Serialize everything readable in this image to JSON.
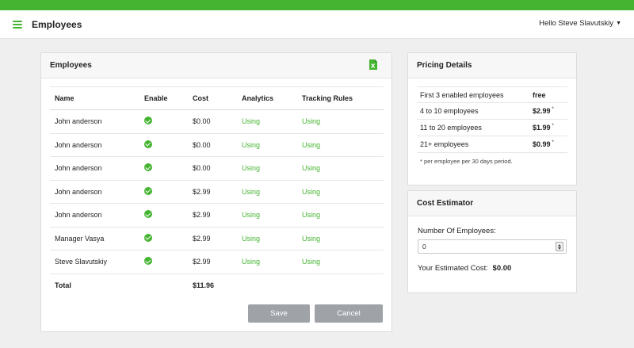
{
  "colors": {
    "accent": "#45b431",
    "button": "#9fa3a8",
    "background": "#efefef"
  },
  "header": {
    "menu_icon": "hamburger-icon",
    "title": "Employees",
    "user_greeting": "Hello Steve Slavutskiy",
    "user_caret": "▼"
  },
  "employees": {
    "title": "Employees",
    "export_icon": "excel-export-icon",
    "columns": {
      "name": "Name",
      "enable": "Enable",
      "cost": "Cost",
      "analytics": "Analytics",
      "tracking_rules": "Tracking Rules"
    },
    "rows": [
      {
        "name": "John anderson",
        "enabled": true,
        "cost": "$0.00",
        "analytics": "Using",
        "tracking_rules": "Using"
      },
      {
        "name": "John anderson",
        "enabled": true,
        "cost": "$0.00",
        "analytics": "Using",
        "tracking_rules": "Using"
      },
      {
        "name": "John anderson",
        "enabled": true,
        "cost": "$0.00",
        "analytics": "Using",
        "tracking_rules": "Using"
      },
      {
        "name": "John anderson",
        "enabled": true,
        "cost": "$2.99",
        "analytics": "Using",
        "tracking_rules": "Using"
      },
      {
        "name": "John anderson",
        "enabled": true,
        "cost": "$2.99",
        "analytics": "Using",
        "tracking_rules": "Using"
      },
      {
        "name": "Manager Vasya",
        "enabled": true,
        "cost": "$2.99",
        "analytics": "Using",
        "tracking_rules": "Using"
      },
      {
        "name": "Steve Slavutskiy",
        "enabled": true,
        "cost": "$2.99",
        "analytics": "Using",
        "tracking_rules": "Using"
      }
    ],
    "total_label": "Total",
    "total_cost": "$11.96",
    "save_label": "Save",
    "cancel_label": "Cancel"
  },
  "pricing": {
    "title": "Pricing Details",
    "tiers": [
      {
        "label": "First 3 enabled employees",
        "price": "free",
        "mark": ""
      },
      {
        "label": "4 to 10 employees",
        "price": "$2.99",
        "mark": "*"
      },
      {
        "label": "11 to 20 employees",
        "price": "$1.99",
        "mark": "*"
      },
      {
        "label": "21+ employees",
        "price": "$0.99",
        "mark": "*"
      }
    ],
    "note": "* per employee per 30 days period."
  },
  "estimator": {
    "title": "Cost Estimator",
    "field_label": "Number Of Employees:",
    "field_value": "0",
    "estimate_label": "Your Estimated Cost:",
    "estimate_value": "$0.00"
  }
}
